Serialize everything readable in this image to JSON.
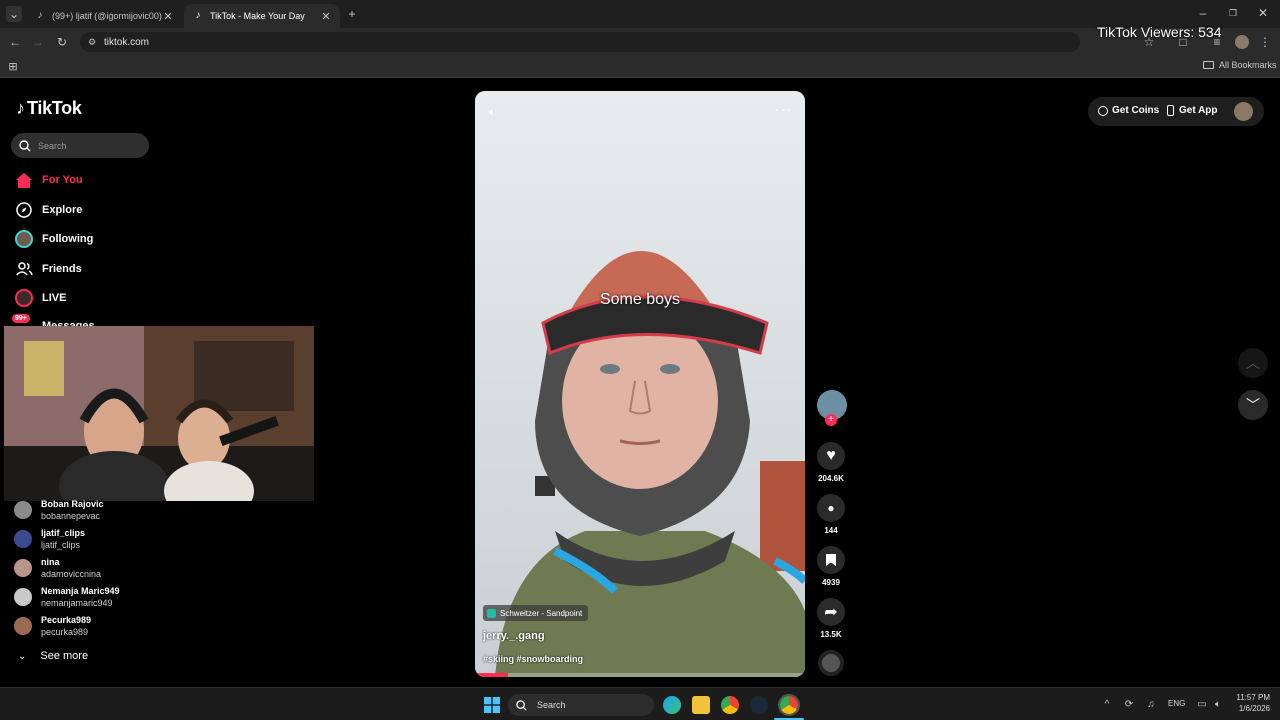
{
  "overlay": {
    "viewers": "TikTok Viewers: 534"
  },
  "browser": {
    "tabs": [
      {
        "title": "(99+) ljatif (@igormijovic00) | Ti",
        "icon": "tiktok-icon"
      },
      {
        "title": "TikTok - Make Your Day",
        "icon": "tiktok-icon"
      }
    ],
    "url": "tiktok.com",
    "bookmarks_label": "All Bookmarks"
  },
  "tiktok": {
    "logo": "TikTok",
    "search_placeholder": "Search",
    "nav": [
      {
        "label": "For You",
        "icon": "home-icon",
        "active": true
      },
      {
        "label": "Explore",
        "icon": "compass-icon"
      },
      {
        "label": "Following",
        "icon": "following-avatar-icon"
      },
      {
        "label": "Friends",
        "icon": "friends-icon"
      },
      {
        "label": "LIVE",
        "icon": "live-icon"
      },
      {
        "label": "Messages",
        "icon": "messages-icon",
        "badge": "99+"
      }
    ],
    "following_accounts": [
      {
        "name": "Boban Rajovic",
        "handle": "bobannepevac"
      },
      {
        "name": "ljatif_clips",
        "handle": "ljatif_clips"
      },
      {
        "name": "nina",
        "handle": "adamoviccnina"
      },
      {
        "name": "Nemanja Maric949",
        "handle": "nemanjamaric949"
      },
      {
        "name": "Pecurka989",
        "handle": "pecurka989"
      }
    ],
    "see_more": "See more",
    "header": {
      "get_coins": "Get Coins",
      "get_app": "Get App"
    },
    "video": {
      "caption_overlay": "Some boys",
      "location": "Schweitzer - Sandpoint",
      "author": "jerry._.gang",
      "hashtags": "#skiing #snowboarding",
      "progress": 0.1
    },
    "actions": {
      "likes": "204.6K",
      "comments": "144",
      "saves": "4939",
      "shares": "13.5K"
    }
  },
  "taskbar": {
    "search": "Search",
    "lang": "ENG",
    "time": "11:57 PM",
    "date": "1/6/2026"
  }
}
